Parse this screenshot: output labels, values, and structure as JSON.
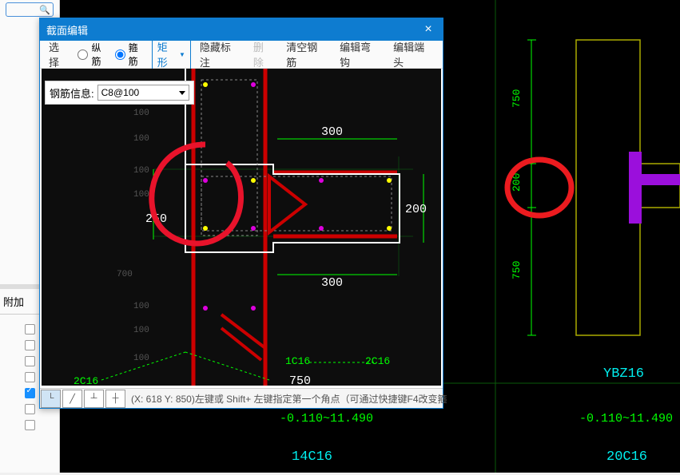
{
  "left_panel": {
    "tab_label": "附加",
    "checkboxes": [
      false,
      false,
      false,
      false,
      true,
      false,
      false
    ]
  },
  "dialog": {
    "title": "截面编辑",
    "toolbar": {
      "select": "选择",
      "radio_longit": "纵筋",
      "radio_hoop": "箍筋",
      "rect": "矩形",
      "hide_annot": "隐藏标注",
      "delete": "删除",
      "clear_bar": "清空钢筋",
      "edit_hook": "编辑弯钩",
      "edit_end": "编辑端头"
    },
    "info": {
      "label": "钢筋信息:",
      "value": "C8@100"
    },
    "canvas": {
      "dims": {
        "top": "300",
        "mid": "200",
        "left": "250",
        "bottom_right": "300",
        "bottom_mid": "750",
        "side_vals": [
          "100",
          "100",
          "100",
          "100",
          "700",
          "100",
          "100",
          "100"
        ]
      },
      "rebar": {
        "left": "2C16",
        "right": "2C16",
        "mid": "1C16"
      }
    },
    "status": {
      "text": "(X: 618 Y: 850)左键或 Shift+ 左键指定第一个角点（可通过快捷键F4改变箍"
    }
  },
  "main_canvas": {
    "dims": {
      "top": "750",
      "mid": "200",
      "bottom": "750"
    },
    "left_view": {
      "label": "14C16",
      "range": "-0.110~11.490"
    },
    "right_view": {
      "label": "YBZ16",
      "range": "-0.110~11.490",
      "count": "20C16"
    }
  }
}
